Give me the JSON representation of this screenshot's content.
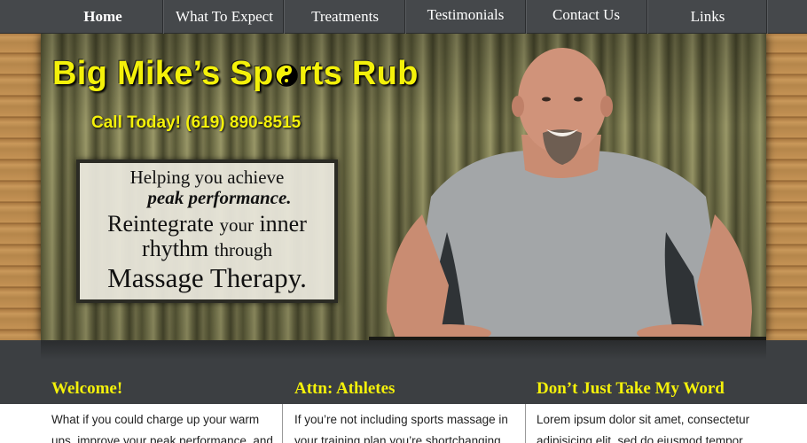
{
  "nav": {
    "items": [
      {
        "label": "Home",
        "active": true
      },
      {
        "label": "What To Expect",
        "active": false
      },
      {
        "label": "Treatments",
        "active": false
      },
      {
        "label": "Testimonials",
        "active": false
      },
      {
        "label": "Contact Us",
        "active": false
      },
      {
        "label": "Links",
        "active": false
      }
    ]
  },
  "hero": {
    "title_part1": "Big Mike’s Sp",
    "title_part2": "rts Rub",
    "phone": "Call Today! (619) 890-8515",
    "tagline": {
      "line1": "Helping you achieve",
      "line2": "peak performance.",
      "line3_a": "Reintegrate",
      "line3_b": "your",
      "line3_c": "inner",
      "line4_a": "rhythm",
      "line4_b": "through",
      "line5": "Massage Therapy."
    }
  },
  "columns": [
    {
      "title": "Welcome!",
      "text": "What if you could charge up your warm ups, improve your peak performance, and"
    },
    {
      "title": "Attn: Athletes",
      "text": "If you’re not including sports massage in your training plan you’re shortchanging"
    },
    {
      "title": "Don’t Just Take My Word",
      "text": "Lorem ipsum dolor sit amet, consectetur adipisicing elit, sed do eiusmod tempor"
    }
  ],
  "colors": {
    "accent_yellow": "#f4f10a",
    "nav_bg": "#45484b",
    "page_bg": "#3c3f42"
  },
  "icons": {
    "title_o": "yin-yang-icon"
  }
}
